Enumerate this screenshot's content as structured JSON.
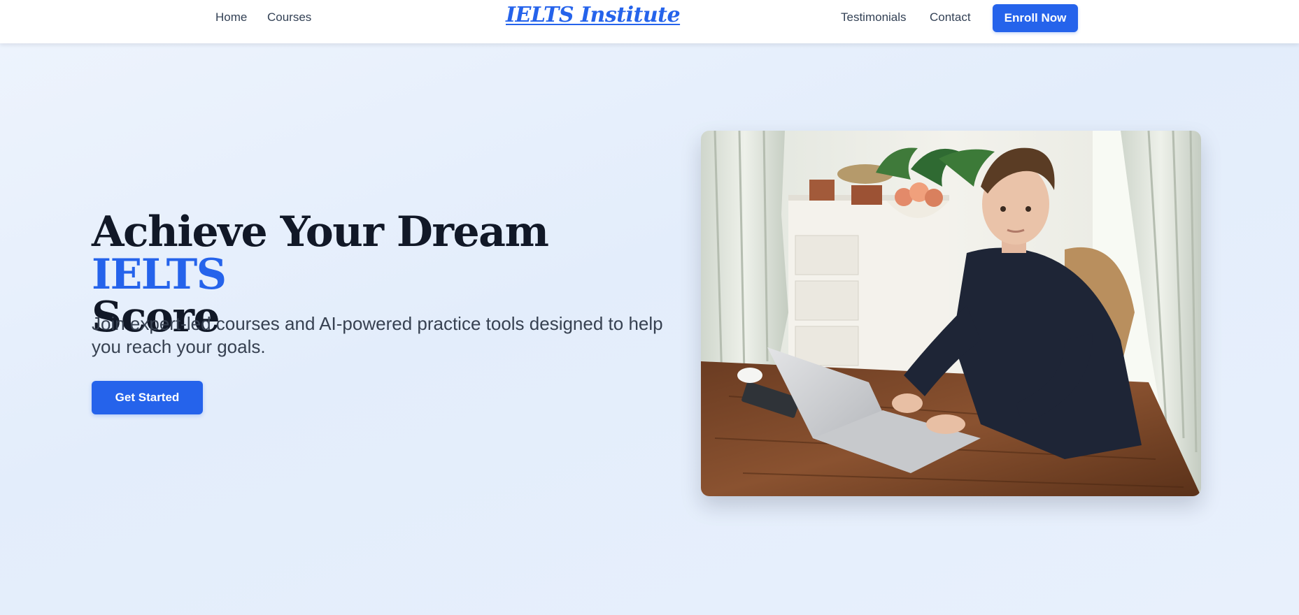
{
  "nav": {
    "links": [
      {
        "label": "Home"
      },
      {
        "label": "Courses"
      },
      {
        "label": "Testimonials"
      },
      {
        "label": "Contact"
      }
    ],
    "logo": "IELTS Institute",
    "enroll_label": "Enroll Now"
  },
  "hero": {
    "title_main": "Achieve Your Dream",
    "title_accent": "IELTS",
    "title_end": "Score",
    "subtitle": "Join expert-led courses and AI-powered practice tools designed to help you reach your goals.",
    "cta_label": "Get Started",
    "image_subject": "student-with-laptop-photo"
  },
  "colors": {
    "accent": "#2563eb",
    "heading": "#111827",
    "body_text": "#374151",
    "background": "#e8f0fc"
  }
}
